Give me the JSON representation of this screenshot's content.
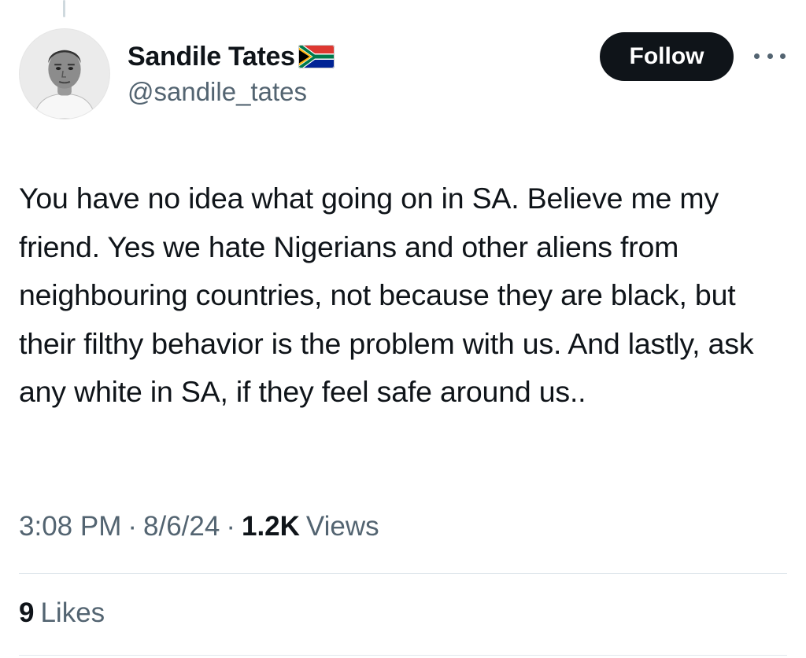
{
  "author": {
    "display_name": "Sandile Tates",
    "handle": "@sandile_tates",
    "flag": "south-africa-flag-emoji"
  },
  "actions": {
    "follow_label": "Follow",
    "more_icon": "more-horizontal-icon"
  },
  "tweet": {
    "text": "You have no idea what going on in SA. Believe me my friend. Yes we hate Nigerians and other aliens from neighbouring countries, not because they are black, but their filthy behavior is the problem with us. And lastly, ask any white in SA, if they feel safe around us..",
    "time": "3:08 PM",
    "date": "8/6/24",
    "separator": "·",
    "views_count": "1.2K",
    "views_label": "Views"
  },
  "engagement": {
    "likes_count": "9",
    "likes_label": "Likes"
  },
  "colors": {
    "text_primary": "#0f1419",
    "text_secondary": "#536471",
    "follow_button_bg": "#0f1419",
    "divider": "#e1e8ed"
  }
}
